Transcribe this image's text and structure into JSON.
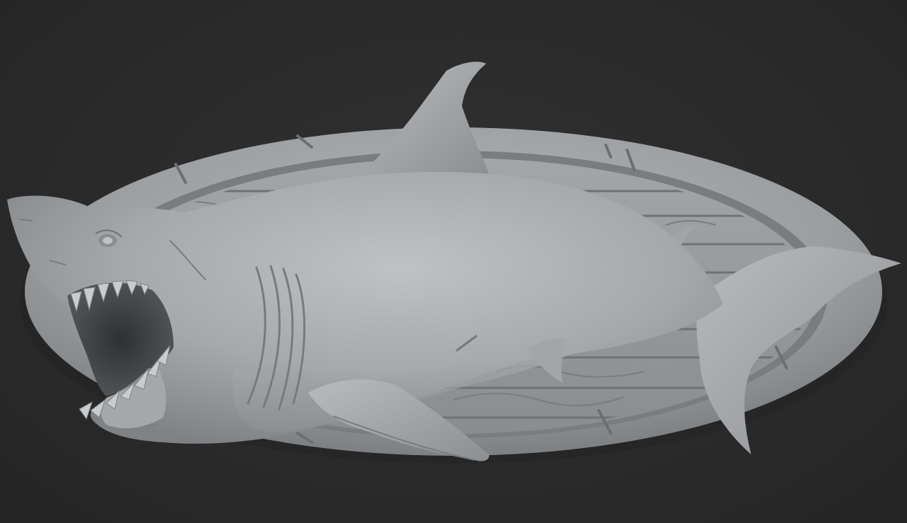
{
  "scene": {
    "subject": "shark",
    "mount": "oval-wood-plaque",
    "material": "clay",
    "colors": {
      "background": "#2b2b2b",
      "clay_light": "#b6b8bb",
      "clay_mid": "#9b9ea1",
      "clay_dark": "#6f7275",
      "shadow": "#4a4c4e",
      "mouth": "#3d3f41"
    }
  }
}
